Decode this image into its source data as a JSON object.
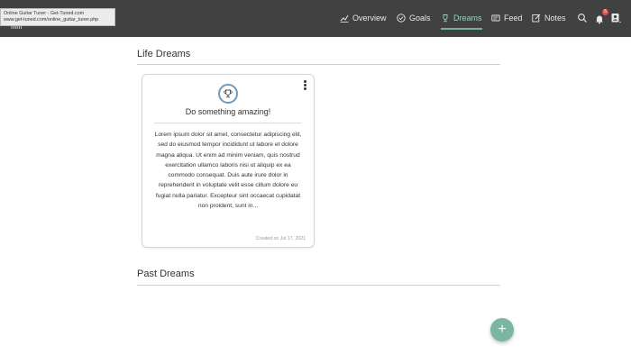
{
  "tooltip": {
    "line1": "Online Guitar Tuner - Get-Tuned.com",
    "line2": "www.get-tuned.com/online_guitar_tuner.php"
  },
  "nav": {
    "items": [
      {
        "label": "Overview",
        "icon": "chart-line-icon"
      },
      {
        "label": "Goals",
        "icon": "check-circle-icon"
      },
      {
        "label": "Dreams",
        "icon": "trophy-icon",
        "active": true
      },
      {
        "label": "Feed",
        "icon": "feed-icon"
      },
      {
        "label": "Notes",
        "icon": "edit-icon"
      }
    ],
    "notification_count": "5"
  },
  "sections": {
    "life_dreams": "Life Dreams",
    "past_dreams": "Past Dreams"
  },
  "dream_card": {
    "title": "Do something amazing!",
    "body": "Lorem ipsum dolor sit amet, consectetur adipiscing elit, sed do eiusmod tempor incididunt ut labore et dolore magna aliqua. Ut enim ad minim veniam, quis nostrud exercitation ullamco laboris nisi ut aliquip ex ea commodo consequat. Duis aute irure dolor in reprehenderit in voluptate velit esse cillum dolore eu fugiat nulla pariatur. Excepteur sint occaecat cupidatat non proident, sunt in...",
    "created": "Created on Jul 17, 2021"
  },
  "fab": {
    "label": "+"
  },
  "colors": {
    "topbar": "#414141",
    "accent": "#7bb5a3",
    "active_nav": "#9fd1c2",
    "badge": "#d9534f"
  }
}
